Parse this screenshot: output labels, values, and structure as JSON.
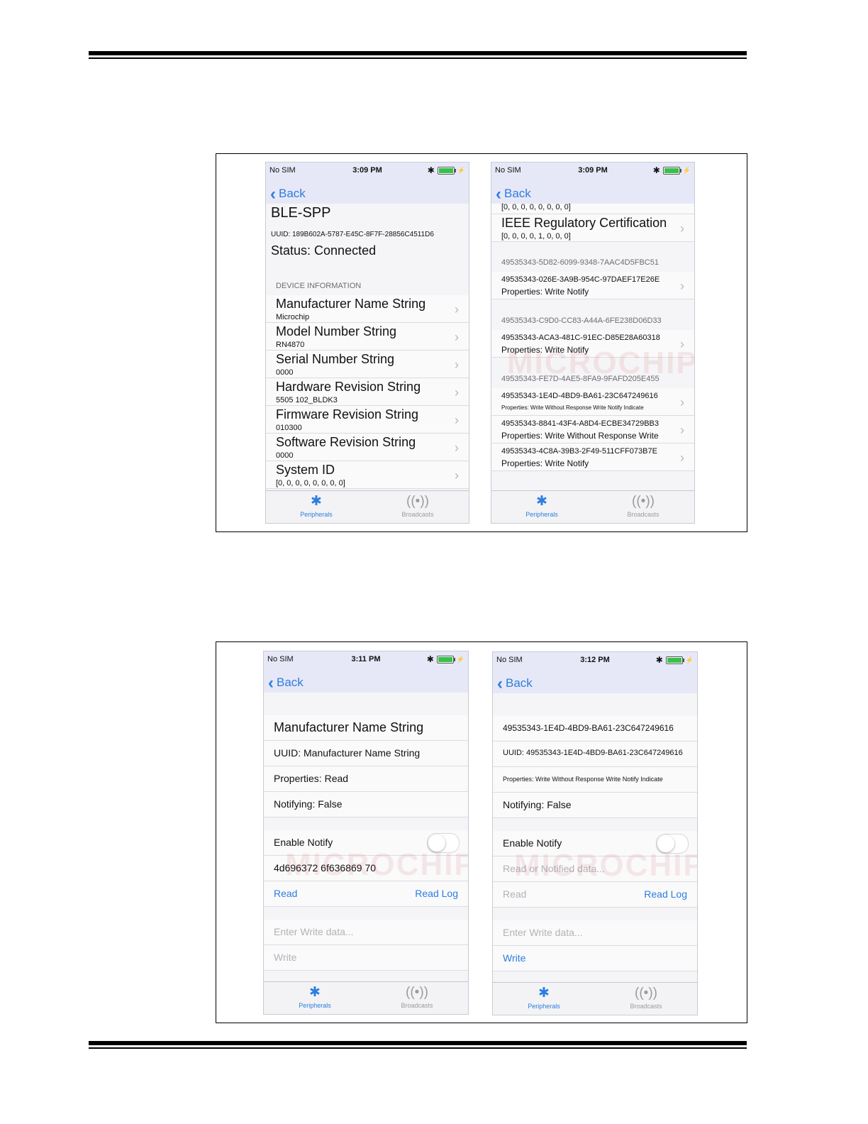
{
  "figure1": {
    "phone_left": {
      "status": {
        "carrier": "No SIM",
        "time": "3:09 PM"
      },
      "back_label": "Back",
      "device_name": "BLE-SPP",
      "uuid": "UUID: 189B602A-5787-E45C-8F7F-28856C4511D6",
      "status_text": "Status: Connected",
      "section_header": "DEVICE INFORMATION",
      "rows": [
        {
          "title": "Manufacturer Name String",
          "value": "Microchip"
        },
        {
          "title": "Model Number String",
          "value": "RN4870"
        },
        {
          "title": "Serial Number String",
          "value": "0000"
        },
        {
          "title": "Hardware Revision String",
          "value": "5505 102_BLDK3"
        },
        {
          "title": "Firmware Revision String",
          "value": "010300"
        },
        {
          "title": "Software Revision String",
          "value": "0000"
        },
        {
          "title": "System ID",
          "value": "[0, 0, 0, 0, 0, 0, 0, 0]"
        }
      ],
      "tabs": {
        "peripherals": "Peripherals",
        "broadcasts": "Broadcasts"
      }
    },
    "phone_right": {
      "status": {
        "carrier": "No SIM",
        "time": "3:09 PM"
      },
      "back_label": "Back",
      "top_partial": "[0, 0, 0, 0, 0, 0, 0, 0]",
      "ieee": {
        "title": "IEEE Regulatory Certification",
        "value": "[0, 0, 0, 0, 1, 0, 0, 0]"
      },
      "services": [
        {
          "header": "49535343-5D82-6099-9348-7AAC4D5FBC51",
          "chars": [
            {
              "uuid": "49535343-026E-3A9B-954C-97DAEF17E26E",
              "props": "Properties: Write Notify"
            }
          ]
        },
        {
          "header": "49535343-C9D0-CC83-A44A-6FE238D06D33",
          "chars": [
            {
              "uuid": "49535343-ACA3-481C-91EC-D85E28A60318",
              "props": "Properties: Write Notify"
            }
          ]
        },
        {
          "header": "49535343-FE7D-4AE5-8FA9-9FAFD205E455",
          "chars": [
            {
              "uuid": "49535343-1E4D-4BD9-BA61-23C647249616",
              "props": "Properties: Write Without Response Write Notify Indicate"
            },
            {
              "uuid": "49535343-8841-43F4-A8D4-ECBE34729BB3",
              "props": "Properties: Write Without Response Write"
            },
            {
              "uuid": "49535343-4C8A-39B3-2F49-511CFF073B7E",
              "props": "Properties: Write Notify"
            }
          ]
        }
      ],
      "tabs": {
        "peripherals": "Peripherals",
        "broadcasts": "Broadcasts"
      }
    }
  },
  "figure2": {
    "phone_left": {
      "status": {
        "carrier": "No SIM",
        "time": "3:11 PM"
      },
      "back_label": "Back",
      "title": "Manufacturer Name String",
      "uuid": "UUID: Manufacturer Name String",
      "properties": "Properties: Read",
      "notifying": "Notifying: False",
      "enable_notify": "Enable Notify",
      "read_data": "4d696372 6f636869 70",
      "read_label": "Read",
      "read_log_label": "Read Log",
      "write_placeholder": "Enter Write data...",
      "write_label": "Write",
      "tabs": {
        "peripherals": "Peripherals",
        "broadcasts": "Broadcasts"
      }
    },
    "phone_right": {
      "status": {
        "carrier": "No SIM",
        "time": "3:12 PM"
      },
      "back_label": "Back",
      "title": "49535343-1E4D-4BD9-BA61-23C647249616",
      "uuid": "UUID: 49535343-1E4D-4BD9-BA61-23C647249616",
      "properties": "Properties: Write Without Response Write Notify Indicate",
      "notifying": "Notifying: False",
      "enable_notify": "Enable Notify",
      "read_placeholder": "Read or Notified data...",
      "read_label": "Read",
      "read_log_label": "Read Log",
      "write_placeholder": "Enter Write data...",
      "write_label": "Write",
      "tabs": {
        "peripherals": "Peripherals",
        "broadcasts": "Broadcasts"
      }
    }
  },
  "colors": {
    "accent": "#2c7de0",
    "navbar": "#e7e8f7",
    "battery": "#35c24a"
  },
  "icons": [
    "bluetooth-icon",
    "battery-icon",
    "chevron-left-icon",
    "chevron-right-icon",
    "broadcast-icon"
  ]
}
